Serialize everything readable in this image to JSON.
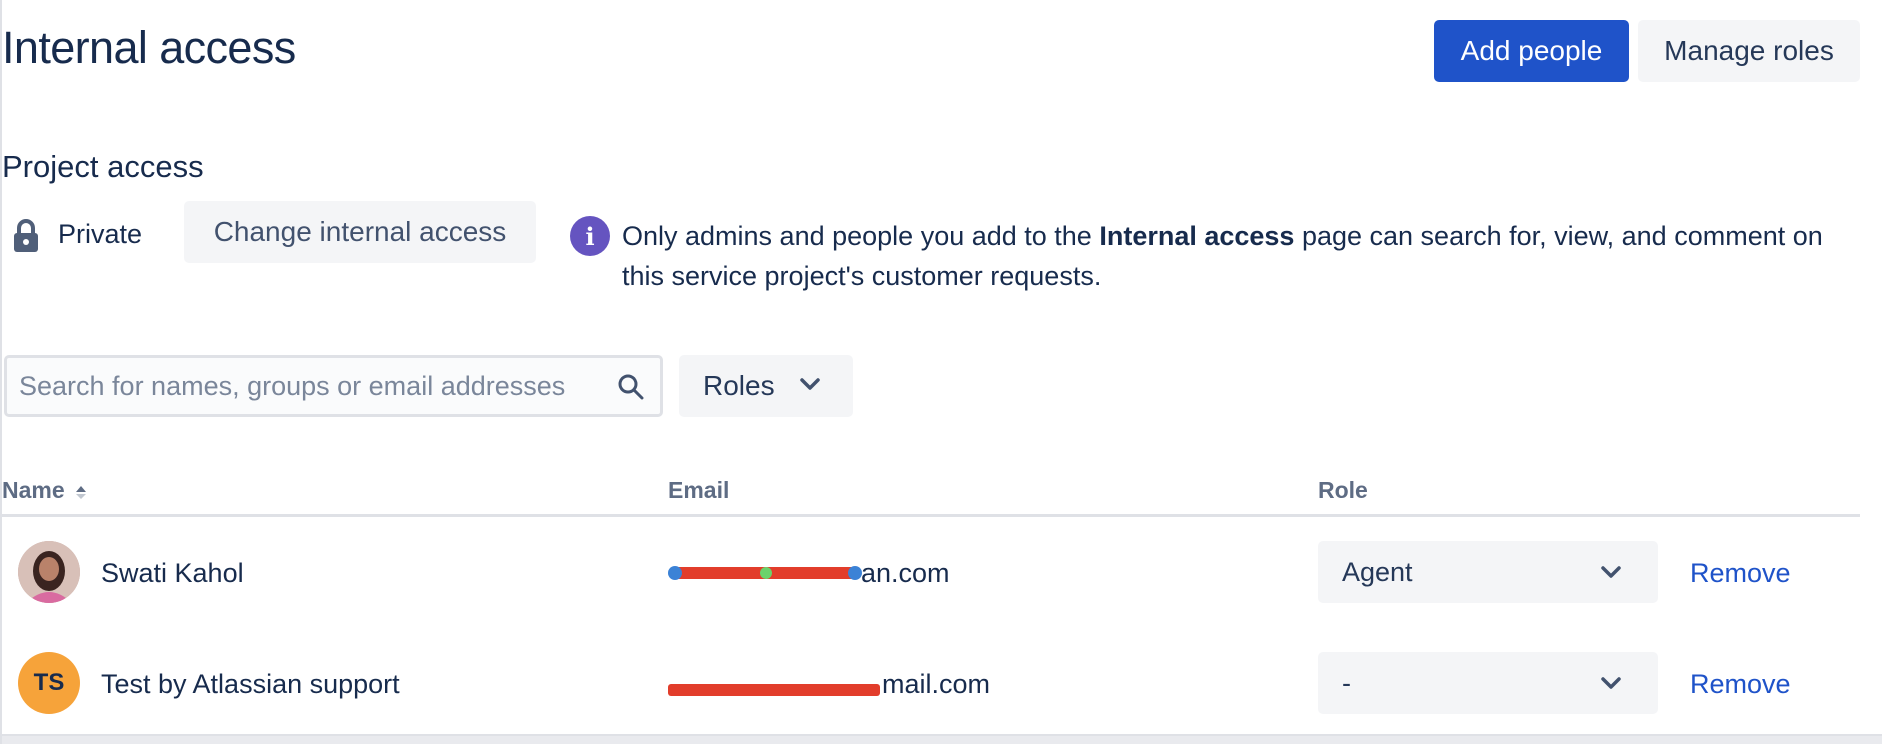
{
  "header": {
    "title": "Internal access",
    "add_people_label": "Add people",
    "manage_roles_label": "Manage roles"
  },
  "project_access": {
    "title": "Project access",
    "visibility_label": "Private",
    "change_button_label": "Change internal access",
    "info_text_before": "Only admins and people you add to the ",
    "info_text_bold": "Internal access",
    "info_text_after": " page can search for, view, and comment on this service project's customer requests."
  },
  "filters": {
    "search_placeholder": "Search for names, groups or email addresses",
    "search_value": "",
    "roles_label": "Roles"
  },
  "table": {
    "columns": {
      "name": "Name",
      "email": "Email",
      "role": "Role"
    },
    "rows": [
      {
        "name": "Swati Kahol",
        "avatar": "photo",
        "email_visible": "an.com",
        "role": "Agent",
        "action": "Remove"
      },
      {
        "name": "Test by Atlassian support",
        "avatar_initials": "TS",
        "email_visible": "mail.com",
        "role": "-",
        "action": "Remove"
      }
    ]
  },
  "colors": {
    "primary": "#1f53c9",
    "text": "#172b4d",
    "info_icon": "#6554c0",
    "avatar_initials_bg": "#f6a33a",
    "redaction": "#e23d2b"
  },
  "icons": {
    "lock": "lock-icon",
    "info": "info-icon",
    "search": "search-icon",
    "chevron": "chevron-down-icon",
    "sort": "sort-icon"
  }
}
